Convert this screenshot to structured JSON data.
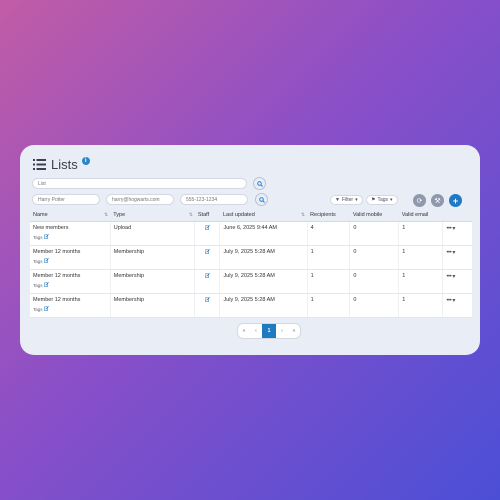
{
  "header": {
    "title": "Lists",
    "info_icon": "info-icon"
  },
  "search": {
    "main_placeholder": "List",
    "name_placeholder": "Harry Potter",
    "email_placeholder": "harry@hogwarts.com",
    "phone_placeholder": "555-123-1234"
  },
  "toolbar": {
    "filter_label": "Filter",
    "tags_label": "Tags",
    "add_label": "+"
  },
  "table": {
    "columns": [
      "Name",
      "Type",
      "Staff",
      "Last updated",
      "Recipients",
      "Valid mobile",
      "Valid email",
      ""
    ],
    "tags_label": "Tags",
    "rows": [
      {
        "name": "New members",
        "type": "Upload",
        "updated": "June 6, 2025 9:44 AM",
        "recipients": "4",
        "mobile": "0",
        "email": "1",
        "actions": "••• ▾"
      },
      {
        "name": "Member 12 months",
        "type": "Membership",
        "updated": "July 9, 2025 5:28 AM",
        "recipients": "1",
        "mobile": "0",
        "email": "1",
        "actions": "••• ▾"
      },
      {
        "name": "Member 12 months",
        "type": "Membership",
        "updated": "July 9, 2025 5:28 AM",
        "recipients": "1",
        "mobile": "0",
        "email": "1",
        "actions": "••• ▾"
      },
      {
        "name": "Member 12 months",
        "type": "Membership",
        "updated": "July 9, 2025 5:28 AM",
        "recipients": "1",
        "mobile": "0",
        "email": "1",
        "actions": "••• ▾"
      }
    ]
  },
  "pagination": {
    "first": "«",
    "prev": "‹",
    "current": "1",
    "next": "›",
    "last": "»"
  }
}
